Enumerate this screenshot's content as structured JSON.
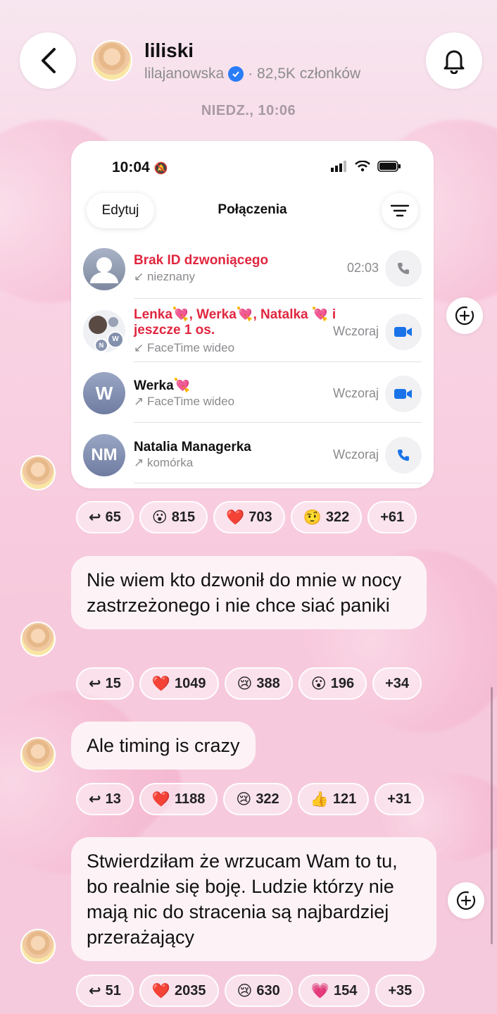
{
  "header": {
    "channel_name": "liliski",
    "handle": "lilajanowska",
    "members": "· 82,5K członków"
  },
  "date_separator": "NIEDZ., 10:06",
  "screenshot": {
    "status_time": "10:04",
    "edit_label": "Edytuj",
    "title": "Połączenia",
    "calls": [
      {
        "name": "Brak ID dzwoniącego",
        "sub": "↙ nieznany",
        "time": "02:03",
        "missed": true,
        "avatar_text": "",
        "action": "phone"
      },
      {
        "name": "Lenka💘, Werka💘, Natalka 💘 i jeszcze 1 os.",
        "sub": "↙ FaceTime wideo",
        "time": "Wczoraj",
        "missed": true,
        "avatar_text": "",
        "action": "video"
      },
      {
        "name": "Werka💘",
        "sub": "↗ FaceTime wideo",
        "time": "Wczoraj",
        "missed": false,
        "avatar_text": "W",
        "action": "video"
      },
      {
        "name": "Natalia Managerka",
        "sub": "↗ komórka",
        "time": "Wczoraj",
        "missed": false,
        "avatar_text": "NM",
        "action": "phone"
      }
    ]
  },
  "messages": [
    {
      "text": "",
      "reactions": [
        {
          "emoji": "↩",
          "count": "65"
        },
        {
          "emoji": "😮",
          "count": "815"
        },
        {
          "emoji": "❤️",
          "count": "703"
        },
        {
          "emoji": "🤨",
          "count": "322"
        },
        {
          "emoji": "",
          "count": "+61"
        }
      ]
    },
    {
      "text": "Nie wiem kto dzwonił do mnie w nocy zastrzeżonego i nie chce siać paniki",
      "reactions": [
        {
          "emoji": "↩",
          "count": "15"
        },
        {
          "emoji": "❤️",
          "count": "1049"
        },
        {
          "emoji": "😢",
          "count": "388"
        },
        {
          "emoji": "😮",
          "count": "196"
        },
        {
          "emoji": "",
          "count": "+34"
        }
      ]
    },
    {
      "text": "Ale timing is crazy",
      "reactions": [
        {
          "emoji": "↩",
          "count": "13"
        },
        {
          "emoji": "❤️",
          "count": "1188"
        },
        {
          "emoji": "😢",
          "count": "322"
        },
        {
          "emoji": "👍",
          "count": "121"
        },
        {
          "emoji": "",
          "count": "+31"
        }
      ]
    },
    {
      "text": "Stwierdziłam że wrzucam Wam to tu, bo realnie się boję. Ludzie którzy nie mają nic do stracenia są najbardziej przerażający",
      "reactions": [
        {
          "emoji": "↩",
          "count": "51"
        },
        {
          "emoji": "❤️",
          "count": "2035"
        },
        {
          "emoji": "😢",
          "count": "630"
        },
        {
          "emoji": "💗",
          "count": "154"
        },
        {
          "emoji": "",
          "count": "+35"
        }
      ]
    }
  ]
}
